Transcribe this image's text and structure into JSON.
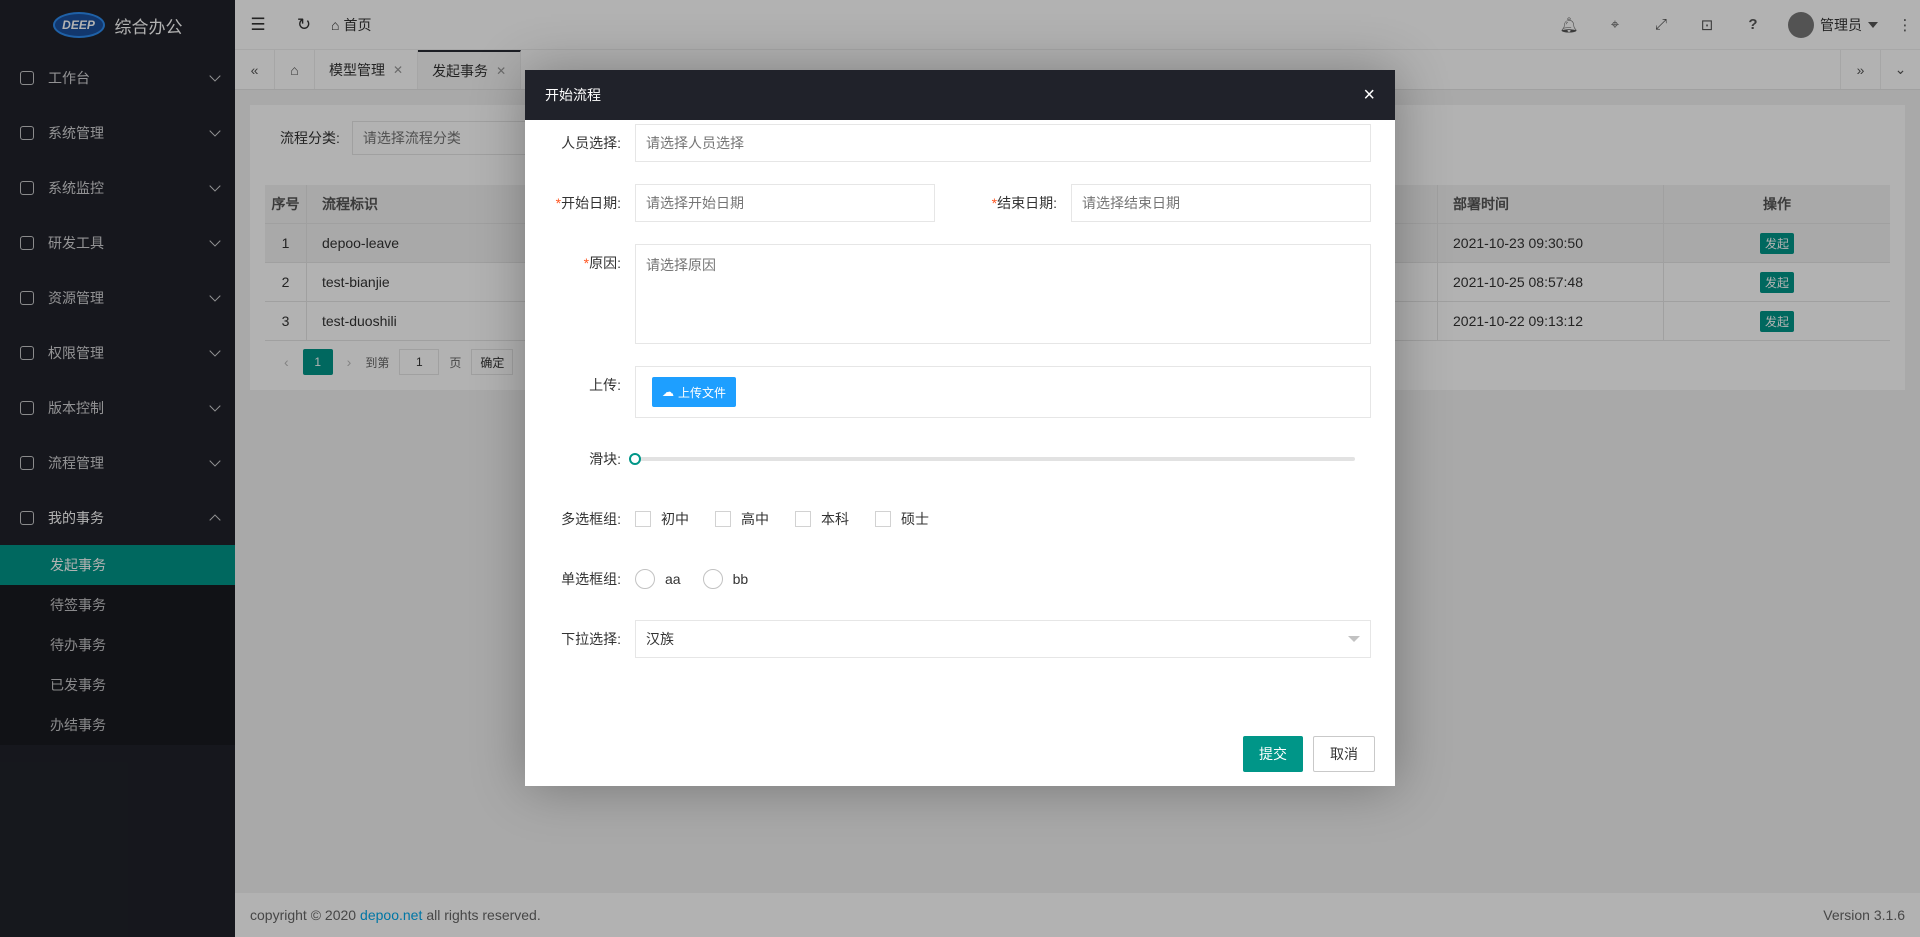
{
  "app": {
    "logo_text": "DEEP",
    "title": "综合办公"
  },
  "sidebar": {
    "menu": [
      {
        "label": "工作台",
        "icon": "home-icon"
      },
      {
        "label": "系统管理",
        "icon": "gear-icon"
      },
      {
        "label": "系统监控",
        "icon": "grid-icon"
      },
      {
        "label": "研发工具",
        "icon": "tools-icon"
      },
      {
        "label": "资源管理",
        "icon": "compass-icon"
      },
      {
        "label": "权限管理",
        "icon": "shield-icon"
      },
      {
        "label": "版本控制",
        "icon": "code-icon"
      },
      {
        "label": "流程管理",
        "icon": "flow-icon"
      },
      {
        "label": "我的事务",
        "icon": "compass-icon"
      }
    ],
    "submenu": [
      {
        "label": "发起事务",
        "active": true
      },
      {
        "label": "待签事务"
      },
      {
        "label": "待办事务"
      },
      {
        "label": "已发事务"
      },
      {
        "label": "办结事务"
      }
    ]
  },
  "header": {
    "home_label": "首页",
    "user_name": "管理员",
    "icons": [
      "bell-icon",
      "tag-icon",
      "fullscreen-icon",
      "lock-icon",
      "help-icon",
      "more-icon"
    ]
  },
  "tabs": [
    {
      "label": "模型管理"
    },
    {
      "label": "发起事务",
      "active": true
    }
  ],
  "filter": {
    "label": "流程分类:",
    "placeholder": "请选择流程分类"
  },
  "table": {
    "headers": {
      "no": "序号",
      "key": "流程标识",
      "time": "部署时间",
      "op": "操作"
    },
    "rows": [
      {
        "no": "1",
        "key": "depoo-leave",
        "time": "2021-10-23 09:30:50",
        "op": "发起"
      },
      {
        "no": "2",
        "key": "test-bianjie",
        "time": "2021-10-25 08:57:48",
        "op": "发起"
      },
      {
        "no": "3",
        "key": "test-duoshili",
        "time": "2021-10-22 09:13:12",
        "op": "发起"
      }
    ],
    "pager": {
      "current": "1",
      "goto_label": "到第",
      "goto_value": "1",
      "page_unit": "页",
      "confirm": "确定"
    }
  },
  "footer": {
    "prefix": "copyright © 2020 ",
    "link": "depoo.net",
    "suffix": " all rights reserved.",
    "version": "Version 3.1.6"
  },
  "modal": {
    "title": "开始流程",
    "fields": {
      "person_label": "人员选择:",
      "person_placeholder": "请选择人员选择",
      "start_label": "开始日期:",
      "start_placeholder": "请选择开始日期",
      "end_label": "结束日期:",
      "end_placeholder": "请选择结束日期",
      "reason_label": "原因:",
      "reason_placeholder": "请选择原因",
      "upload_label": "上传:",
      "upload_button": "上传文件",
      "slider_label": "滑块:",
      "slider_value": 0,
      "checkbox_label": "多选框组:",
      "checkbox_options": [
        "初中",
        "高中",
        "本科",
        "硕士"
      ],
      "radio_label": "单选框组:",
      "radio_options": [
        "aa",
        "bb"
      ],
      "select_label": "下拉选择:",
      "select_value": "汉族"
    },
    "submit": "提交",
    "cancel": "取消"
  }
}
